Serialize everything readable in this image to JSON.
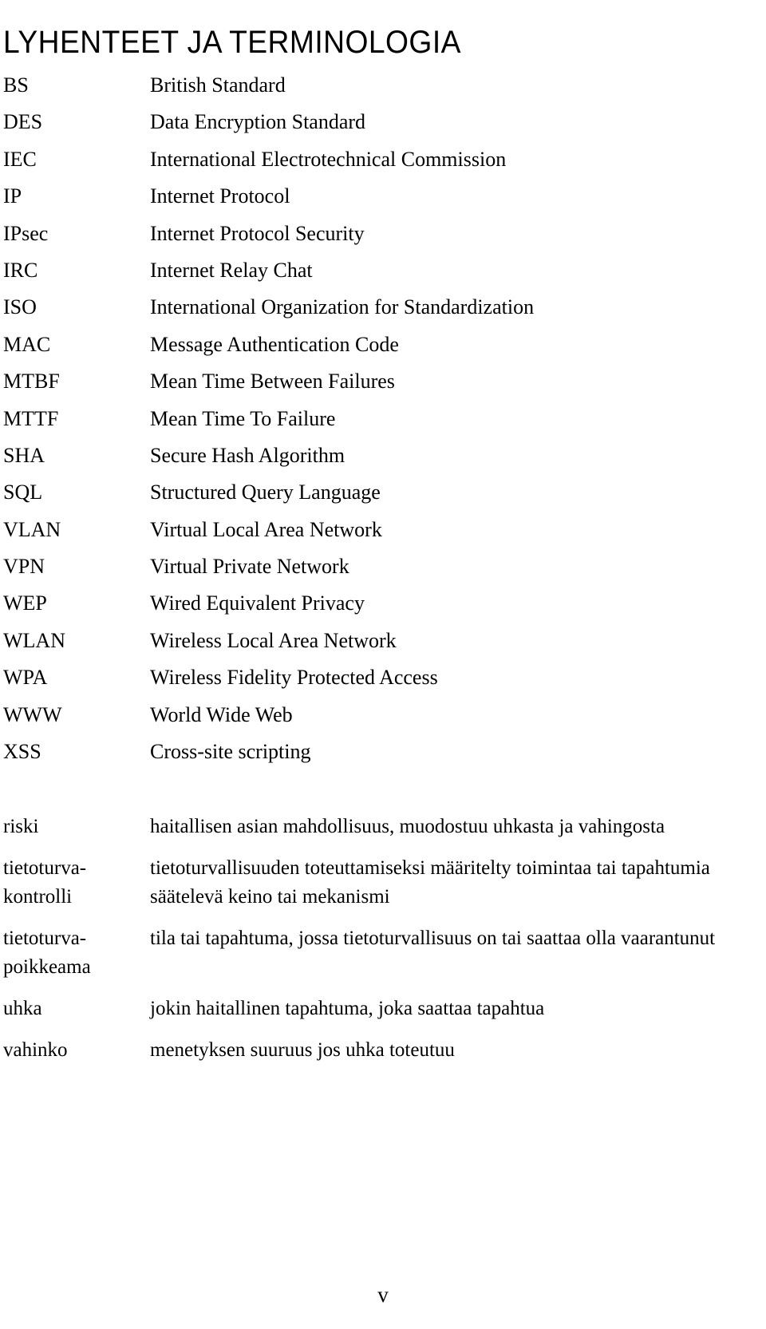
{
  "document": {
    "title": "LYHENTEET JA TERMINOLOGIA",
    "page_number": "v"
  },
  "abbreviations": [
    {
      "term": "BS",
      "definition": "British Standard"
    },
    {
      "term": "DES",
      "definition": "Data Encryption Standard"
    },
    {
      "term": "IEC",
      "definition": "International Electrotechnical Commission"
    },
    {
      "term": "IP",
      "definition": "Internet Protocol"
    },
    {
      "term": "IPsec",
      "definition": "Internet Protocol Security"
    },
    {
      "term": "IRC",
      "definition": "Internet Relay Chat"
    },
    {
      "term": "ISO",
      "definition": "International Organization for Standardization"
    },
    {
      "term": "MAC",
      "definition": "Message Authentication Code"
    },
    {
      "term": "MTBF",
      "definition": "Mean Time Between Failures"
    },
    {
      "term": "MTTF",
      "definition": "Mean Time To Failure"
    },
    {
      "term": "SHA",
      "definition": "Secure Hash Algorithm"
    },
    {
      "term": "SQL",
      "definition": "Structured Query Language"
    },
    {
      "term": "VLAN",
      "definition": "Virtual Local Area Network"
    },
    {
      "term": "VPN",
      "definition": "Virtual Private Network"
    },
    {
      "term": "WEP",
      "definition": "Wired Equivalent Privacy"
    },
    {
      "term": "WLAN",
      "definition": "Wireless Local Area Network"
    },
    {
      "term": "WPA",
      "definition": "Wireless Fidelity Protected Access"
    },
    {
      "term": "WWW",
      "definition": "World Wide Web"
    },
    {
      "term": "XSS",
      "definition": "Cross-site scripting"
    }
  ],
  "terminology": [
    {
      "term_lines": [
        "riski"
      ],
      "definition_lines": [
        "haitallisen asian mahdollisuus, muodostuu uhkasta ja vahingosta"
      ]
    },
    {
      "term_lines": [
        "tietoturva-",
        "kontrolli"
      ],
      "definition_lines": [
        "tietoturvallisuuden toteuttamiseksi määritelty toimintaa tai tapahtumia",
        "säätelevä keino tai mekanismi"
      ]
    },
    {
      "term_lines": [
        "tietoturva-",
        "poikkeama"
      ],
      "definition_lines": [
        "tila tai tapahtuma, jossa tietoturvallisuus on tai saattaa olla vaarantunut"
      ]
    },
    {
      "term_lines": [
        "uhka"
      ],
      "definition_lines": [
        "jokin haitallinen tapahtuma, joka saattaa tapahtua"
      ]
    },
    {
      "term_lines": [
        "vahinko"
      ],
      "definition_lines": [
        "menetyksen suuruus jos uhka toteutuu"
      ]
    }
  ]
}
